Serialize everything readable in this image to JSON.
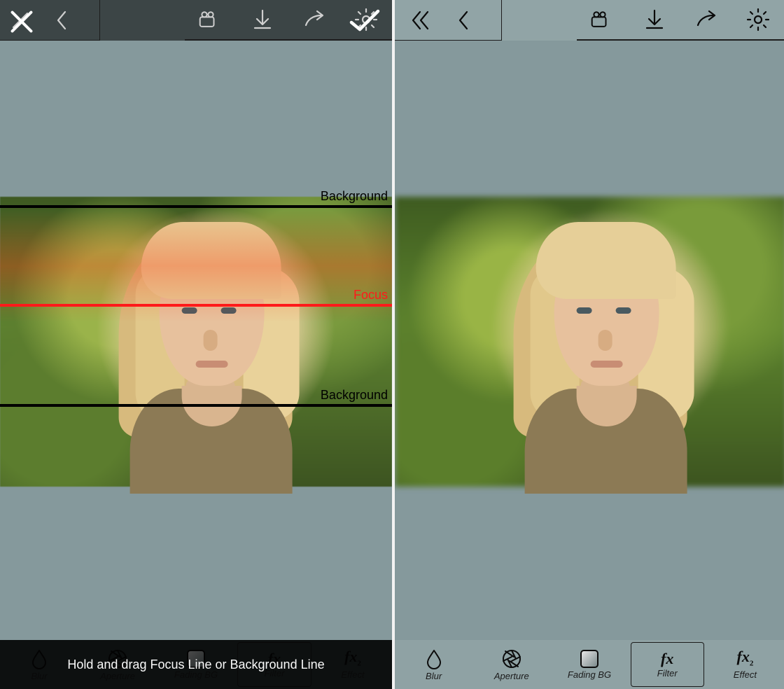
{
  "left": {
    "toolbar": {
      "close": "close",
      "back": "back",
      "video": "video",
      "download": "download",
      "share": "share",
      "settings": "settings",
      "confirm": "confirm"
    },
    "overlay": {
      "focus_label": "Focus",
      "background_label_top": "Background",
      "background_label_bottom": "Background"
    },
    "hint": "Hold and drag Focus Line or Background Line",
    "bottom": {
      "blur": "Blur",
      "aperture": "Aperture",
      "fading": "Fading BG",
      "filter": "Filter",
      "effect": "Effect"
    }
  },
  "right": {
    "toolbar": {
      "first": "first",
      "back": "back",
      "video": "video",
      "download": "download",
      "share": "share",
      "settings": "settings"
    },
    "bottom": {
      "blur": "Blur",
      "aperture": "Aperture",
      "fading": "Fading BG",
      "filter": "Filter",
      "effect": "Effect"
    }
  },
  "colors": {
    "focus_line": "#ff1a1a",
    "bg_line": "#000000",
    "pane_bg": "#85999c"
  }
}
